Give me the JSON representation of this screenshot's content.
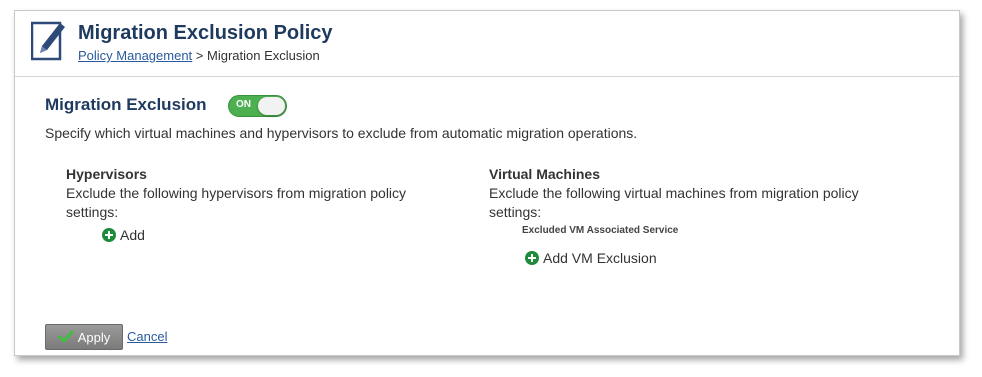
{
  "header": {
    "title": "Migration Exclusion Policy",
    "breadcrumb_link": "Policy Management",
    "breadcrumb_separator": " > ",
    "breadcrumb_current": "Migration Exclusion",
    "icon": "pencil-document-icon"
  },
  "section": {
    "title": "Migration Exclusion",
    "toggle_label": "ON",
    "toggle_state": true,
    "description": "Specify which virtual machines and hypervisors to exclude from automatic migration operations."
  },
  "hypervisors": {
    "title": "Hypervisors",
    "text": "Exclude the following hypervisors from migration policy settings:",
    "add_label": "Add"
  },
  "virtual_machines": {
    "title": "Virtual Machines",
    "text": "Exclude the following virtual machines from migration policy settings:",
    "table_header": "Excluded VM Associated Service",
    "add_label": "Add VM Exclusion"
  },
  "footer": {
    "apply_label": "Apply",
    "cancel_label": "Cancel"
  },
  "colors": {
    "title": "#1f3a5f",
    "link": "#2a5a9c",
    "toggle_on": "#4caf50",
    "add_icon": "#1e8a3a"
  }
}
